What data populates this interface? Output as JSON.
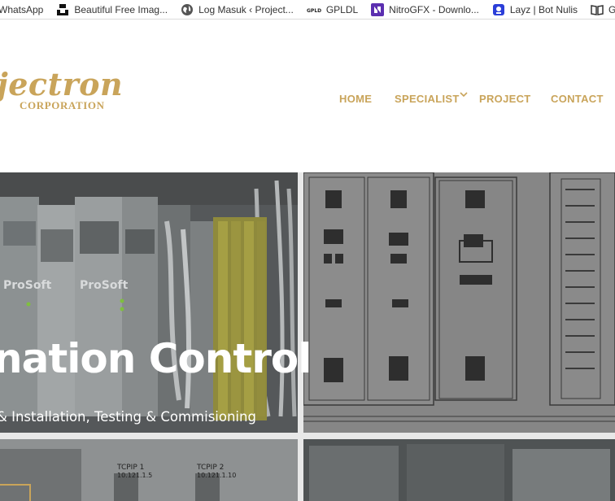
{
  "bookmarks": [
    {
      "label": "WhatsApp",
      "icon": "whatsapp-icon"
    },
    {
      "label": "Beautiful Free Imag...",
      "icon": "unsplash-icon"
    },
    {
      "label": "Log Masuk ‹ Project...",
      "icon": "globe-icon"
    },
    {
      "label": "GPLDL",
      "icon": "gpldl-icon"
    },
    {
      "label": "NitroGFX - Downlo...",
      "icon": "nitrogfx-icon"
    },
    {
      "label": "Layz | Bot Nulis",
      "icon": "layz-icon"
    },
    {
      "label": "G",
      "icon": "book-icon"
    }
  ],
  "logo": {
    "main": "jectron",
    "sub": "CORPORATION",
    "color": "#c9a45a"
  },
  "nav": {
    "home": "HOME",
    "specialist": "SPECIALIST",
    "project": "PROJECT",
    "contact": "CONTACT"
  },
  "hero": {
    "title": "nation Control",
    "subtitle": "& Installation, Testing & Commisioning",
    "accent": "#c9a45a"
  }
}
